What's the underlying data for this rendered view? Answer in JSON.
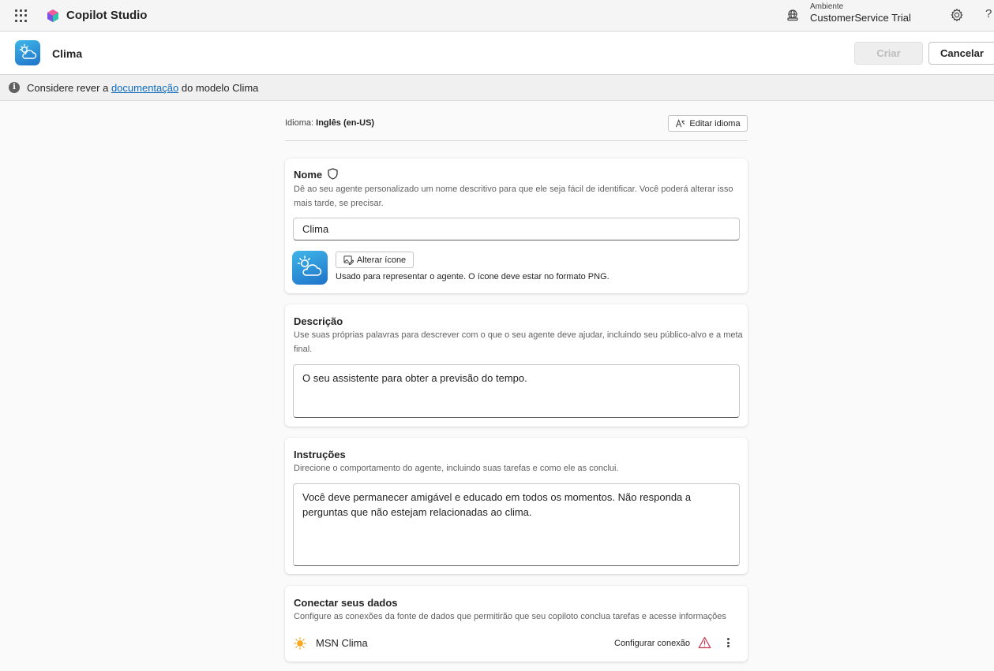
{
  "topbar": {
    "product_name": "Copilot Studio",
    "environment_label": "Ambiente",
    "environment_value": "CustomerService Trial",
    "help_label": "?"
  },
  "subheader": {
    "agent_title": "Clima",
    "create_label": "Criar",
    "cancel_label": "Cancelar"
  },
  "infobar": {
    "info_glyph": "i",
    "prefix": "Considere rever a ",
    "link_text": "documentação",
    "suffix": " do modelo Clima"
  },
  "language": {
    "label": "Idioma: ",
    "value": "Inglês (en-US)",
    "edit_label": "Editar idioma"
  },
  "name_card": {
    "title": "Nome",
    "description": "Dê ao seu agente personalizado um nome descritivo para que ele seja fácil de identificar. Você poderá alterar isso mais tarde, se precisar.",
    "value": "Clima",
    "change_icon_label": "Alterar ícone",
    "icon_hint": "Usado para representar o agente. O ícone deve estar no formato PNG."
  },
  "description_card": {
    "title": "Descrição",
    "description": "Use suas próprias palavras para descrever com o que o seu agente deve ajudar, incluindo seu público-alvo e a meta final.",
    "value": "O seu assistente para obter a previsão do tempo."
  },
  "instructions_card": {
    "title": "Instruções",
    "description": "Direcione o comportamento do agente, incluindo suas tarefas e como ele as conclui.",
    "value": "Você deve permanecer amigável e educado em todos os momentos. Não responda a perguntas que não estejam relacionadas ao clima."
  },
  "data_card": {
    "title": "Conectar seus dados",
    "description": "Configure as conexões da fonte de dados que permitirão que seu copiloto conclua tarefas e acesse informações",
    "sources": [
      {
        "name": "MSN Clima",
        "action_label": "Configurar conexão"
      }
    ]
  },
  "colors": {
    "link": "#0f6cbd",
    "agent_icon_start": "#3fb6e8",
    "agent_icon_end": "#1f73c9",
    "warning": "#c4314b",
    "sun": "#f7a823"
  },
  "icons": [
    "app-launcher-icon",
    "copilot-logo-icon",
    "environment-icon",
    "settings-icon",
    "info-icon",
    "cloud-sun-icon",
    "shield-icon",
    "translate-icon",
    "image-edit-icon",
    "sun-icon",
    "warning-icon",
    "more-options-icon"
  ]
}
